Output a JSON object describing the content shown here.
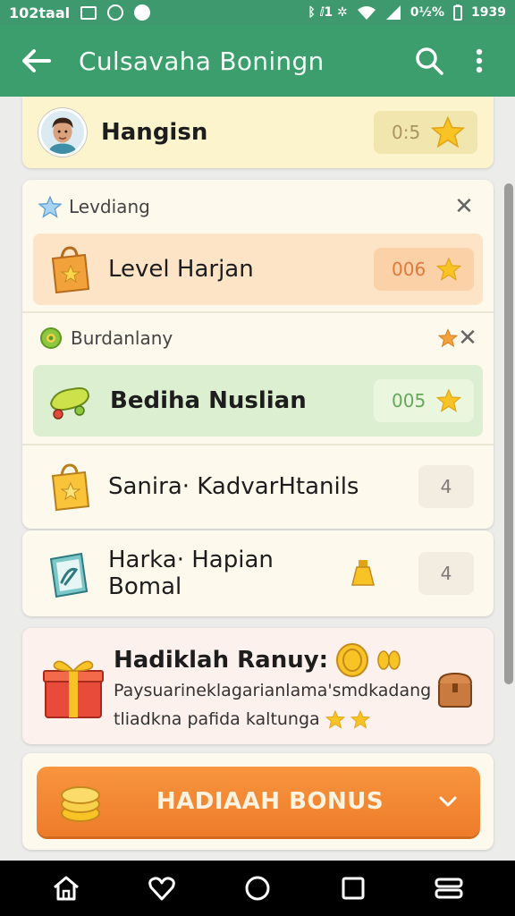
{
  "status_bar": {
    "time": "102taal",
    "right_text": "ᛒ ⅈ1 ✲",
    "battery_percent": "0½%",
    "clock": "1939"
  },
  "app_bar": {
    "title": "Culsavaha Boningn"
  },
  "profile": {
    "name": "Hangisn",
    "points": "0:5"
  },
  "section_levels": {
    "label": "Levdiang",
    "item": {
      "label": "Level Harjan",
      "points": "006"
    }
  },
  "section_budget": {
    "label": "Burdanlany",
    "items": [
      {
        "label": "Bediha Nuslian",
        "points": "005"
      },
      {
        "label": "Sanira· KadvarHtanils",
        "points": "4"
      },
      {
        "label": "Harka· Hapian Bomal",
        "points": "4"
      }
    ]
  },
  "bonus": {
    "title": "Hadiklah Ranuy:",
    "description_line1": "Paysuarineklagarianlama'smdkadang",
    "description_line2": "tliadkna pafida kaltunga"
  },
  "action_button": {
    "label": "HADIAAH BONUS"
  },
  "colors": {
    "app_bar": "#3b9e6c",
    "accent_orange": "#f28a35",
    "star": "#f7c325"
  }
}
